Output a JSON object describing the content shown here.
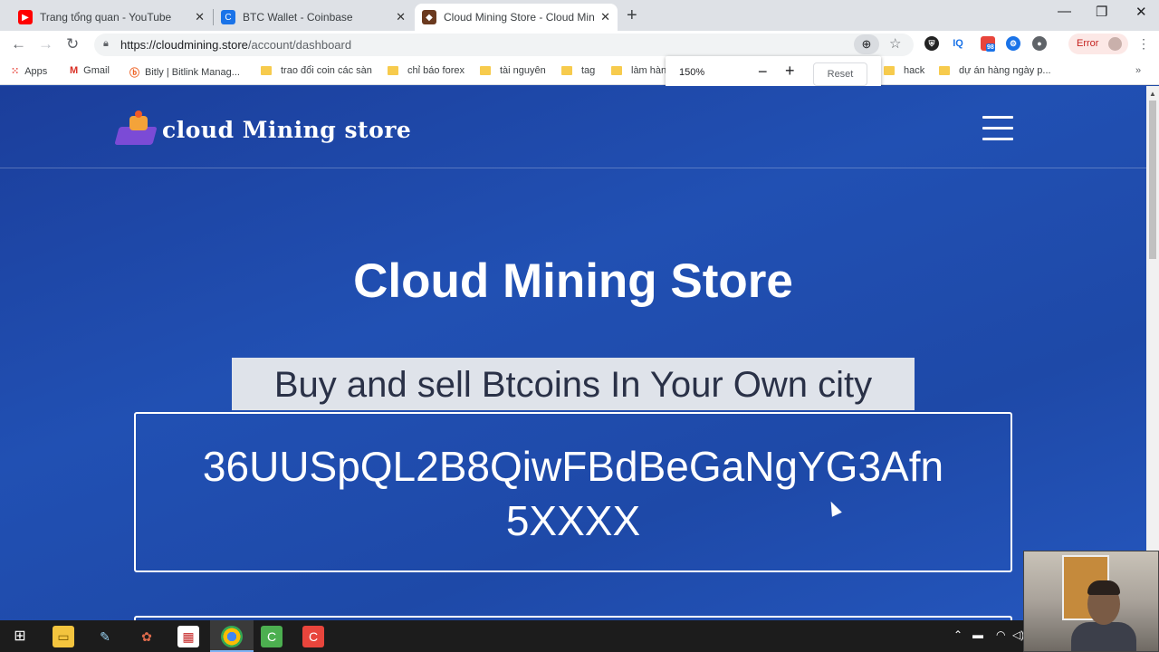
{
  "browser": {
    "tabs": [
      {
        "title": "Trang tổng quan - YouTube",
        "icon": "youtube-icon"
      },
      {
        "title": "BTC Wallet - Coinbase",
        "icon": "coinbase-icon"
      },
      {
        "title": "Cloud Mining Store - Cloud Mini",
        "icon": "cloudmining-icon",
        "active": true
      }
    ],
    "url_host": "https://cloudmining.store",
    "url_path": "/account/dashboard",
    "error_label": "Error",
    "bookmarks": [
      {
        "label": "Apps"
      },
      {
        "label": "Gmail"
      },
      {
        "label": "Bitly | Bitlink Manag..."
      },
      {
        "label": "trao đổi coin các sàn"
      },
      {
        "label": "chỉ báo forex"
      },
      {
        "label": "tài nguyên"
      },
      {
        "label": "tag"
      },
      {
        "label": "làm hàn"
      },
      {
        "label": "hack"
      },
      {
        "label": "dự án hàng ngày p..."
      }
    ],
    "zoom": {
      "percent": "150%",
      "reset_label": "Reset",
      "minus": "−",
      "plus": "+"
    }
  },
  "page": {
    "logo_text": "cloud Mining store",
    "heading": "Cloud Mining Store",
    "subtitle": "Buy and sell Btcoins In Your Own city",
    "address_line1": "36UUSpQL2B8QiwFBdBeGaNgYG3Afn",
    "address_line2": "5XXXX"
  },
  "ext_badge": "98",
  "colors": {
    "page_bg": "#1f4aa8",
    "error_text": "#c5221f"
  }
}
